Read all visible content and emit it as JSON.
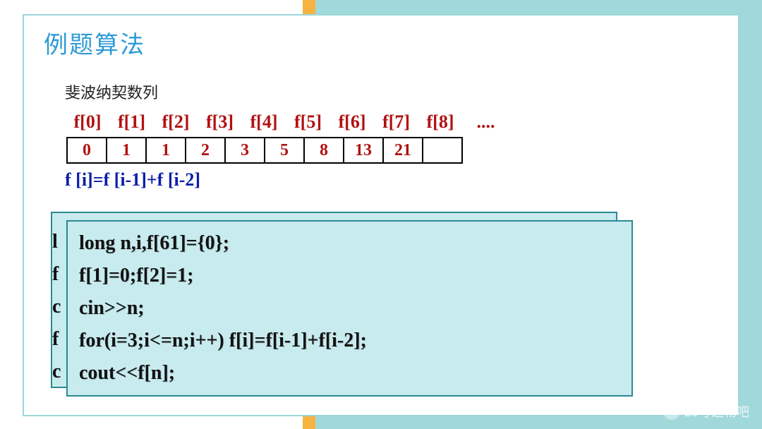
{
  "title": "例题算法",
  "subtitle": "斐波纳契数列",
  "array": {
    "headers": [
      "f[0]",
      "f[1]",
      "f[2]",
      "f[3]",
      "f[4]",
      "f[5]",
      "f[6]",
      "f[7]",
      "f[8]",
      "...."
    ],
    "values": [
      "0",
      "1",
      "1",
      "2",
      "3",
      "5",
      "8",
      "13",
      "21",
      ""
    ]
  },
  "formula": "f [i]=f [i-1]+f [i-2]",
  "code": {
    "lines": [
      "long  n,i,f[61]={0};",
      "f[1]=0;f[2]=1;",
      "cin>>n;",
      "for(i=3;i<=n;i++)  f[i]=f[i-1]+f[i-2];",
      "cout<<f[n];"
    ]
  },
  "ghost": [
    "l",
    "f",
    "c",
    "f",
    "c"
  ],
  "watermark": "29号造物吧"
}
